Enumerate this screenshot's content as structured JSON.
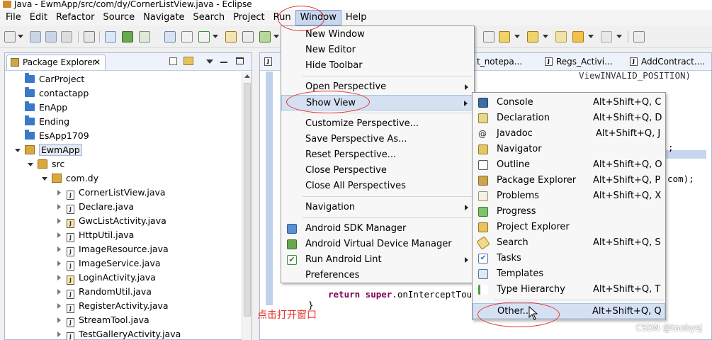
{
  "window": {
    "title": "Java - EwmApp/src/com/dy/CornerListView.java - Eclipse"
  },
  "menubar": [
    "File",
    "Edit",
    "Refactor",
    "Source",
    "Navigate",
    "Search",
    "Project",
    "Run",
    "Window",
    "Help"
  ],
  "package_explorer": {
    "title": "Package Explorer",
    "close": "✕",
    "projects": [
      "CarProject",
      "contactapp",
      "EnApp",
      "Ending",
      "EsApp1709",
      "EwmApp"
    ],
    "src": "src",
    "package": "com.dy",
    "files": [
      "CornerListView.java",
      "Declare.java",
      "GwcListActivity.java",
      "HttpUtil.java",
      "ImageResource.java",
      "ImageService.java",
      "LoginActivity.java",
      "RandomUtil.java",
      "RegisterActivity.java",
      "StreamTool.java",
      "TestGalleryActivity.java"
    ]
  },
  "editor": {
    "tabs": [
      "t_notepa...",
      "Regs_Activi...",
      "AddContract...."
    ],
    "code_top": "ViewINVALID_POSITION)",
    "code_semicolon": ";",
    "code_com": "com);",
    "code_return_kw": "return super",
    "code_return_rest": ".onInterceptTouch",
    "code_brace": "}"
  },
  "window_menu": {
    "items": [
      "New Window",
      "New Editor",
      "Hide Toolbar",
      "Open Perspective",
      "Show View",
      "Customize Perspective...",
      "Save Perspective As...",
      "Reset Perspective...",
      "Close Perspective",
      "Close All Perspectives",
      "Navigation",
      "Android SDK Manager",
      "Android Virtual Device Manager",
      "Run Android Lint",
      "Preferences"
    ]
  },
  "show_view_menu": {
    "items": [
      {
        "label": "Console",
        "shortcut": "Alt+Shift+Q, C"
      },
      {
        "label": "Declaration",
        "shortcut": "Alt+Shift+Q, D"
      },
      {
        "label": "Javadoc",
        "shortcut": "Alt+Shift+Q, J"
      },
      {
        "label": "Navigator",
        "shortcut": ""
      },
      {
        "label": "Outline",
        "shortcut": "Alt+Shift+Q, O"
      },
      {
        "label": "Package Explorer",
        "shortcut": "Alt+Shift+Q, P"
      },
      {
        "label": "Problems",
        "shortcut": "Alt+Shift+Q, X"
      },
      {
        "label": "Progress",
        "shortcut": ""
      },
      {
        "label": "Project Explorer",
        "shortcut": ""
      },
      {
        "label": "Search",
        "shortcut": "Alt+Shift+Q, S"
      },
      {
        "label": "Tasks",
        "shortcut": ""
      },
      {
        "label": "Templates",
        "shortcut": ""
      },
      {
        "label": "Type Hierarchy",
        "shortcut": "Alt+Shift+Q, T"
      },
      {
        "label": "Other...",
        "shortcut": "Alt+Shift+Q, Q"
      }
    ]
  },
  "annotation": "点击打开窗口",
  "watermark": "CSDN @taobysj",
  "colors": {
    "menu_highlight": "#d5e1f2",
    "annotation_red": "#e4312b",
    "selection": "#e3e8f2"
  }
}
